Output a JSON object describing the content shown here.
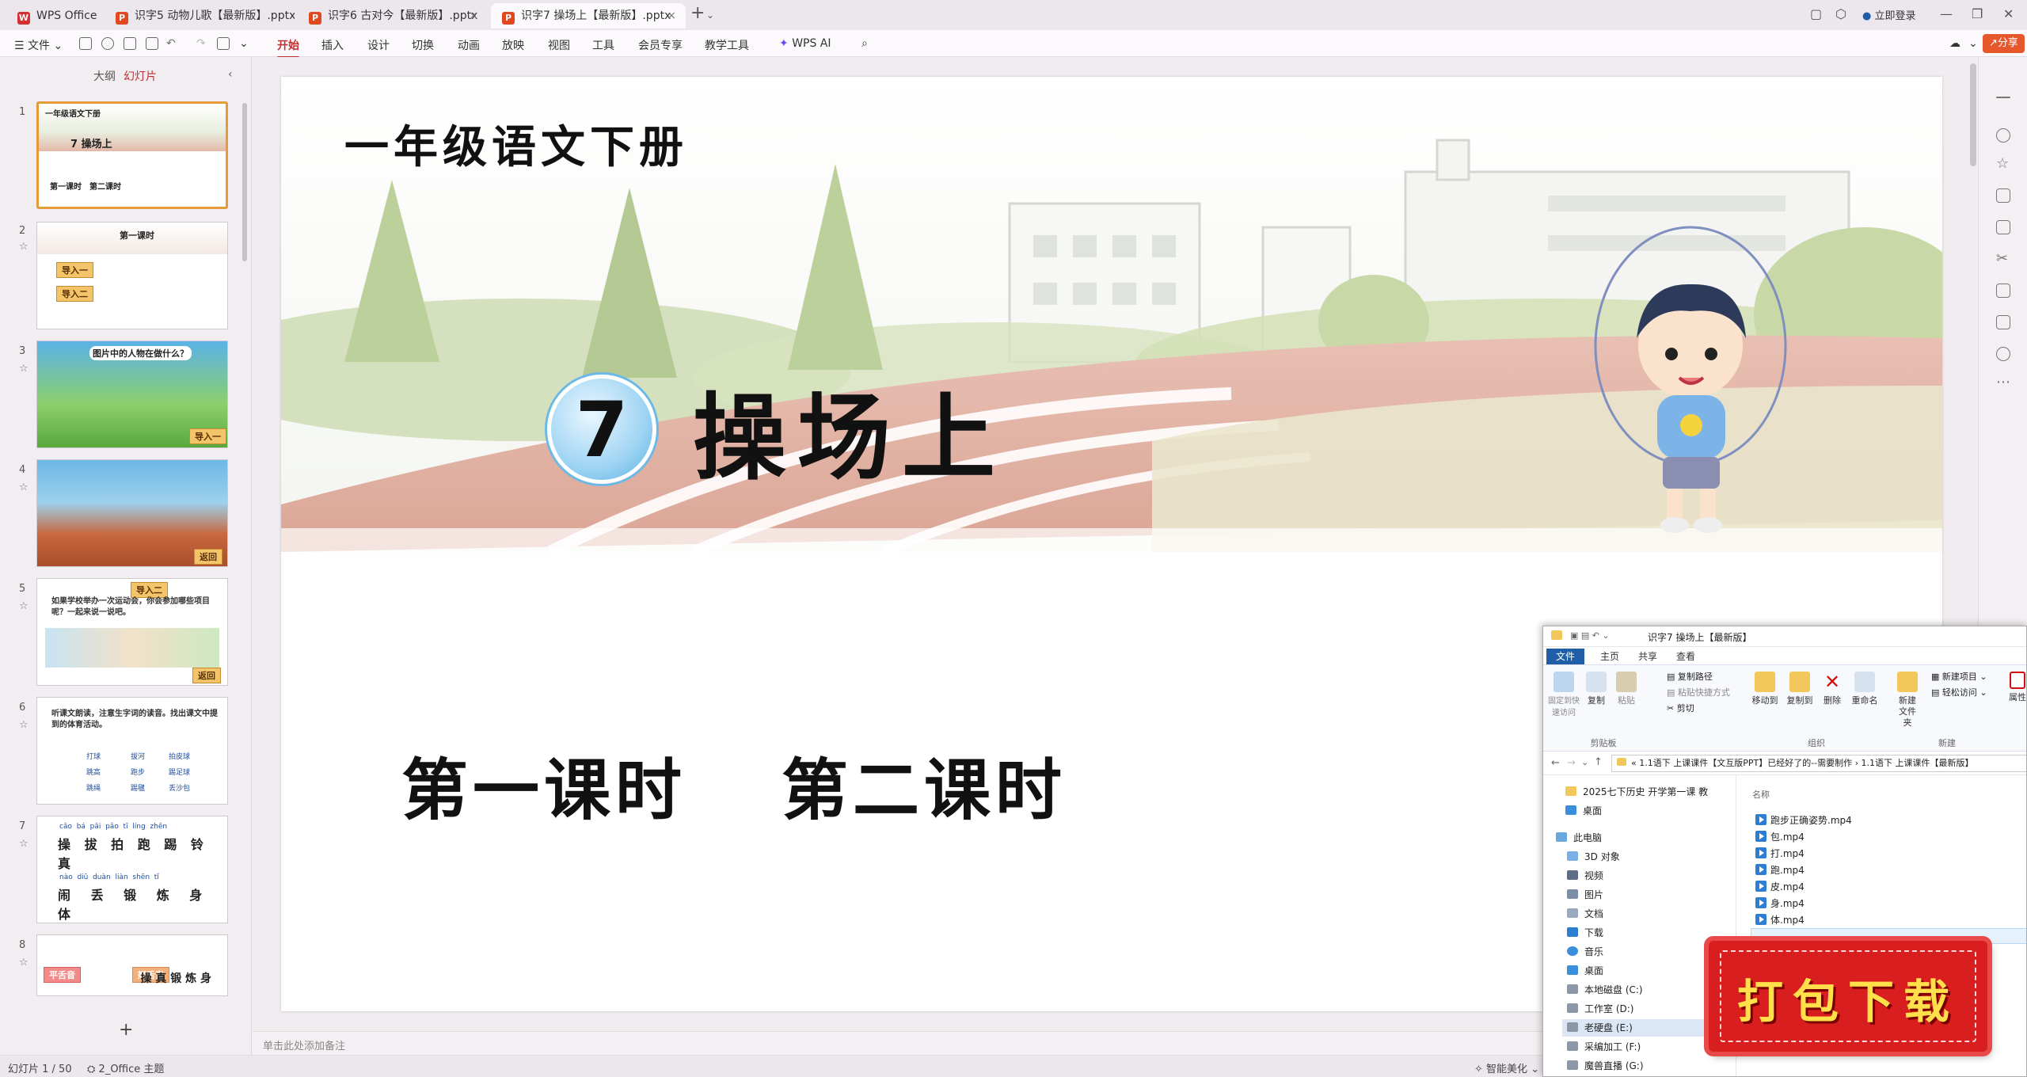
{
  "titlebar": {
    "app_tab": "WPS Office",
    "doc_tabs": [
      {
        "label": "识字5 动物儿歌【最新版】.pptx"
      },
      {
        "label": "识字6 古对今【最新版】.pptx"
      },
      {
        "label": "识字7 操场上【最新版】.pptx"
      }
    ],
    "login": "立即登录"
  },
  "ribbon": {
    "file_menu": "文件",
    "menus": [
      "开始",
      "插入",
      "设计",
      "切换",
      "动画",
      "放映",
      "视图",
      "工具",
      "会员专享",
      "教学工具"
    ],
    "ai": "WPS AI",
    "share": "分享"
  },
  "leftpane": {
    "tabs": [
      "大纲",
      "幻灯片"
    ],
    "slides": [
      {
        "num": "1",
        "title": "一年级语文下册",
        "heading": "7 操场上",
        "sub": "第一课时　第二课时"
      },
      {
        "num": "2",
        "title": "第一课时",
        "tags": [
          "导入一",
          "导入二"
        ]
      },
      {
        "num": "3",
        "title": "图片中的人物在做什么？",
        "tags": [
          "导入一"
        ]
      },
      {
        "num": "4",
        "tags": [
          "返回"
        ]
      },
      {
        "num": "5",
        "title": "如果学校举办一次运动会，你会参加哪些项目呢？一起来说一说吧。",
        "tags": [
          "导入二",
          "返回"
        ]
      },
      {
        "num": "6",
        "title": "听课文朗读，注意生字词的读音。找出课文中提到的体育活动。",
        "words": [
          "打球",
          "拔河",
          "拍皮球",
          "跳高",
          "跑步",
          "踢足球",
          "跳绳",
          "踢毽",
          "丢沙包"
        ]
      },
      {
        "num": "7",
        "pinyin1": "cāo  bá  pāi  pǎo  tī  líng  zhēn",
        "chars1": "操 拔 拍 跑 踢 铃 真",
        "pinyin2": "nào  diū  duàn  liàn  shēn  tǐ",
        "chars2": "闹 丢 锻 炼 身 体"
      },
      {
        "num": "8",
        "tags": [
          "平舌音",
          "翘舌音"
        ],
        "chars": "操 真 锻 炼 身"
      }
    ],
    "add": "+"
  },
  "slide": {
    "title": "一年级语文下册",
    "lesson_number": "7",
    "lesson_title": "操场上",
    "period1": "第一课时",
    "period2": "第二课时"
  },
  "notes_placeholder": "单击此处添加备注",
  "status": {
    "slide_count": "幻灯片 1 / 50",
    "theme": "2_Office 主题",
    "smart": "智能美化"
  },
  "explorer": {
    "title": "识字7 操场上【最新版】",
    "tabs": [
      "文件",
      "主页",
      "共享",
      "查看"
    ],
    "groups": [
      "剪贴板",
      "组织",
      "新建"
    ],
    "buttons": {
      "pin": "固定到快速访问",
      "copy": "复制",
      "paste": "粘贴",
      "copy_path": "复制路径",
      "paste_shortcut": "粘贴快捷方式",
      "cut": "剪切",
      "move_to": "移动到",
      "copy_to": "复制到",
      "delete": "删除",
      "rename": "重命名",
      "new_folder": "新建文件夹",
      "new_item": "新建项目",
      "easy_access": "轻松访问",
      "props": "属性"
    },
    "path": "1.1语下 上课课件【文互版PPT】已经好了的--需要制作 › 1.1语下 上课课件【最新版】",
    "column_name": "名称",
    "tree": [
      "2025七下历史 开学第一课 教",
      "桌面",
      "此电脑",
      "3D 对象",
      "视频",
      "图片",
      "文档",
      "下载",
      "音乐",
      "桌面",
      "本地磁盘 (C:)",
      "工作室 (D:)",
      "老硬盘 (E:)",
      "采编加工 (F:)",
      "魔兽直播 (G:)"
    ],
    "files": [
      "跑步正确姿势.mp4",
      "包.mp4",
      "打.mp4",
      "跑.mp4",
      "皮.mp4",
      "身.mp4",
      "体.mp4"
    ]
  },
  "download_banner": "打包下载"
}
